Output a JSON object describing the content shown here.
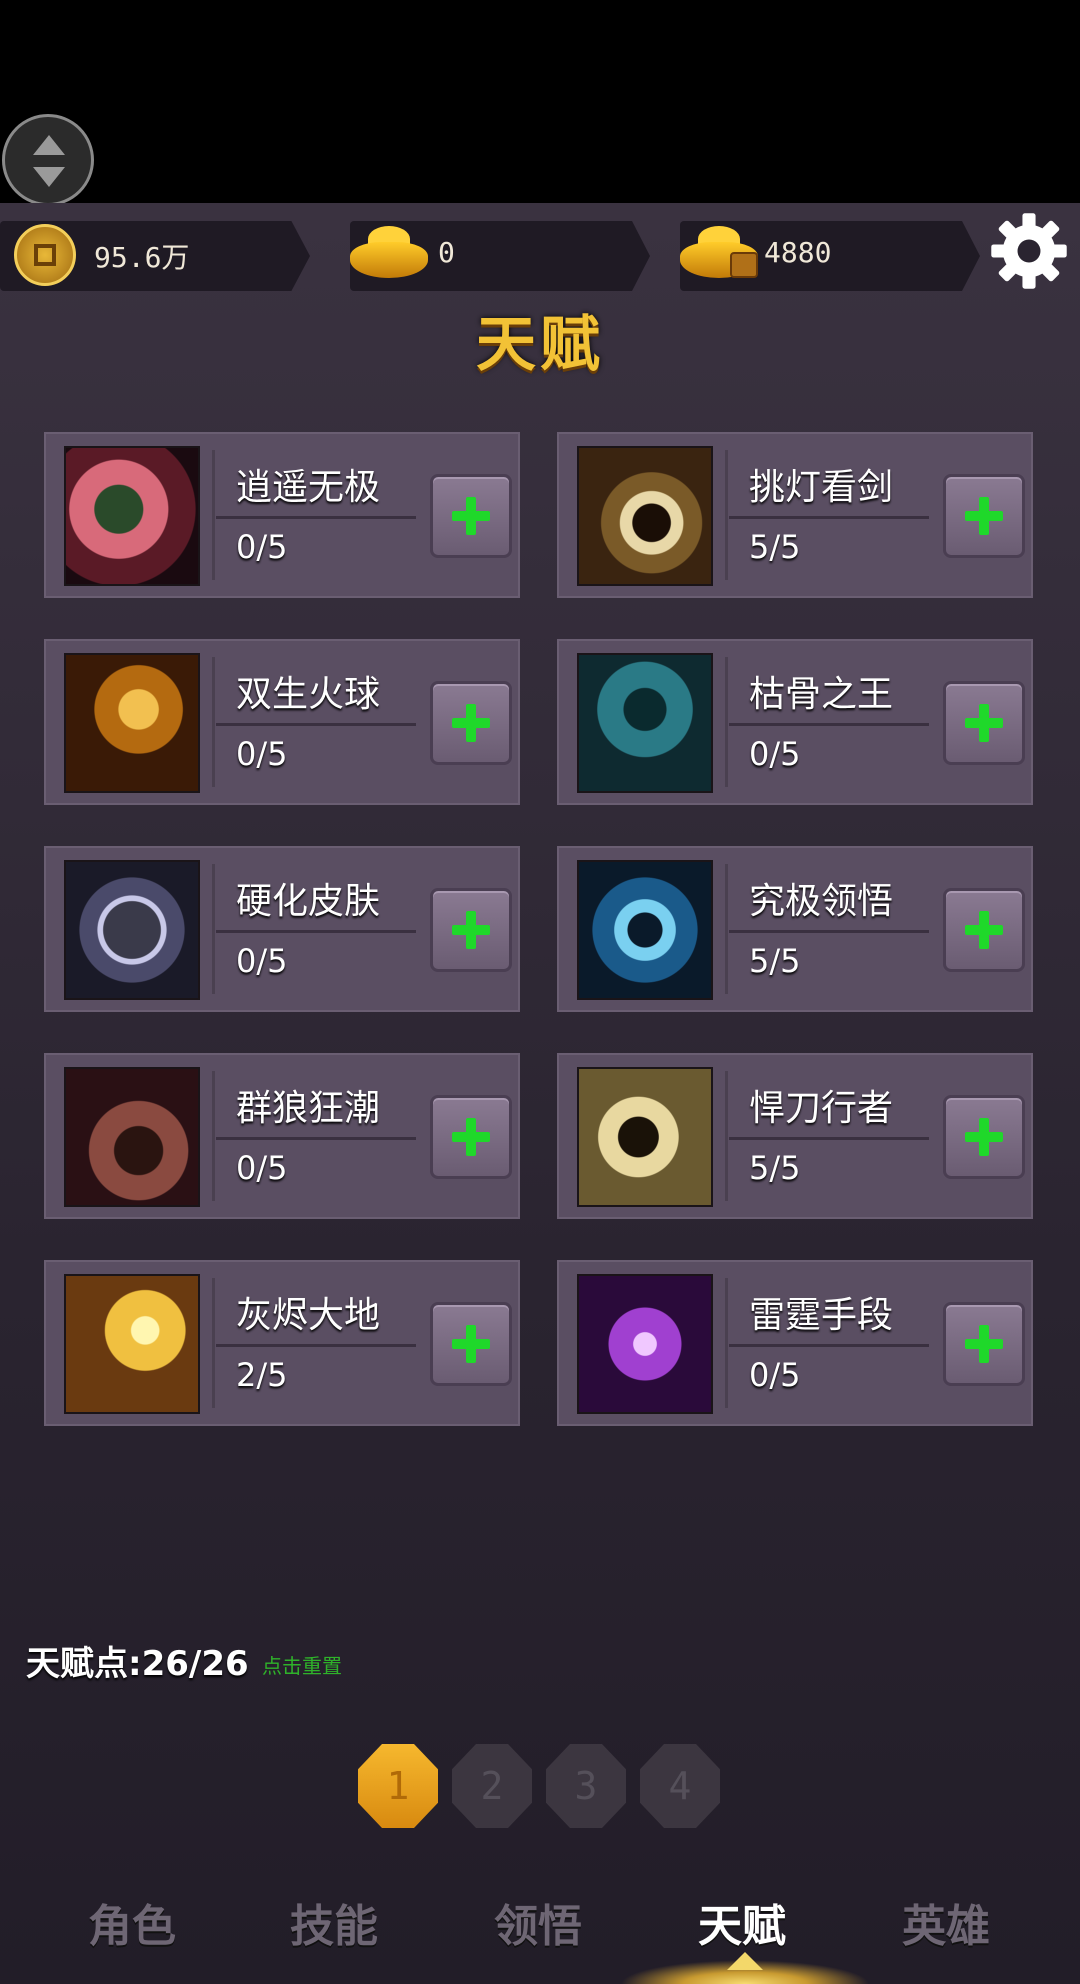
{
  "resources": {
    "coins": "95.6万",
    "ingots": "0",
    "locked_ingots": "4880"
  },
  "page_title": "天赋",
  "talents": [
    {
      "name": "逍遥无极",
      "level": "0/5",
      "art": "hat-slash"
    },
    {
      "name": "挑灯看剑",
      "level": "5/5",
      "art": "sword-swirl"
    },
    {
      "name": "双生火球",
      "level": "0/5",
      "art": "twin-fireball"
    },
    {
      "name": "枯骨之王",
      "level": "0/5",
      "art": "bone-king"
    },
    {
      "name": "硬化皮肤",
      "level": "0/5",
      "art": "hardened-skin"
    },
    {
      "name": "究极领悟",
      "level": "5/5",
      "art": "ultimate-insight"
    },
    {
      "name": "群狼狂潮",
      "level": "0/5",
      "art": "wolf-tide"
    },
    {
      "name": "悍刀行者",
      "level": "5/5",
      "art": "blade-walker"
    },
    {
      "name": "灰烬大地",
      "level": "2/5",
      "art": "ash-earth"
    },
    {
      "name": "雷霆手段",
      "level": "0/5",
      "art": "thunder-fist"
    }
  ],
  "talent_points_label": "天赋点:26/26",
  "reset_label": "点击重置",
  "pages": [
    "1",
    "2",
    "3",
    "4"
  ],
  "active_page": "1",
  "tabs": [
    {
      "label": "角色",
      "active": false
    },
    {
      "label": "技能",
      "active": false
    },
    {
      "label": "领悟",
      "active": false
    },
    {
      "label": "天赋",
      "active": true
    },
    {
      "label": "英雄",
      "active": false
    }
  ],
  "colors": {
    "accent_gold": "#f2c236",
    "plus_green": "#1fd82a",
    "card_bg": "#5a4e62",
    "reset_green": "#2fb22a"
  }
}
